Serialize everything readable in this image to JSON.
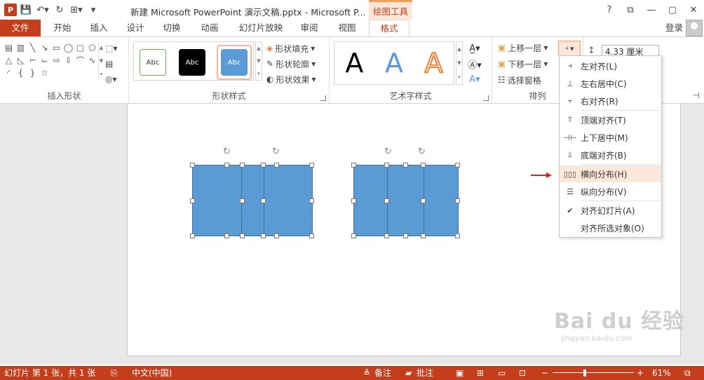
{
  "window": {
    "doc_title": "新建 Microsoft PowerPoint 演示文稿.pptx - Microsoft P...",
    "context_tab": "绘图工具",
    "app_icon": "P",
    "controls": [
      "?",
      "⧉",
      "—",
      "▢",
      "✕"
    ]
  },
  "tabs": {
    "file": "文件",
    "items": [
      "开始",
      "插入",
      "设计",
      "切换",
      "动画",
      "幻灯片放映",
      "审阅",
      "视图",
      "格式"
    ],
    "active": "格式",
    "login": "登录"
  },
  "ribbon": {
    "insert_shapes": {
      "label": "插入形状"
    },
    "shape_styles": {
      "label": "形状样式",
      "swatch_text": "Abc",
      "fill": "形状填充",
      "outline": "形状轮廓",
      "effects": "形状效果"
    },
    "wordart": {
      "label": "艺术字样式",
      "glyph": "A"
    },
    "arrange": {
      "label": "排列",
      "bring_forward": "上移一层",
      "send_backward": "下移一层",
      "selection_pane": "选择窗格"
    },
    "size": {
      "value": "4.33 厘米"
    }
  },
  "align_menu": {
    "items": [
      "左对齐(L)",
      "左右居中(C)",
      "右对齐(R)",
      "顶端对齐(T)",
      "上下居中(M)",
      "底端对齐(B)",
      "横向分布(H)",
      "纵向分布(V)",
      "对齐幻灯片(A)",
      "对齐所选对象(O)"
    ],
    "highlighted": "横向分布(H)",
    "checked": "对齐幻灯片(A)"
  },
  "watermark": {
    "brand": "Bai du 经验",
    "url": "jingyan.baidu.com"
  },
  "status": {
    "slide_info": "幻灯片 第 1 张，共 1 张",
    "language": "中文(中国)",
    "notes": "备注",
    "comments": "批注",
    "zoom": "61%",
    "zoom_minus": "−",
    "zoom_plus": "+"
  },
  "colors": {
    "accent": "#c43e1c",
    "shape_fill": "#5b9bd5",
    "menu_highlight": "#fde7d9"
  }
}
